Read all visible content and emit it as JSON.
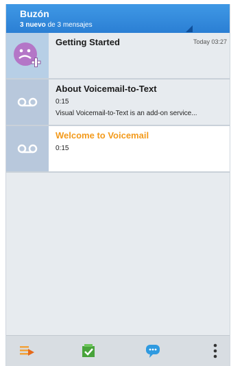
{
  "header": {
    "title": "Buzón",
    "new_count": "3 nuevo",
    "rest": "de 3 mensajes"
  },
  "messages": [
    {
      "name": "Getting Started",
      "time": "Today 03:27",
      "duration": "",
      "preview": "",
      "icon": "contact-avatar-icon",
      "unread": false
    },
    {
      "name": "About Voicemail-to-Text",
      "time": "",
      "duration": "0:15",
      "preview": "Visual Voicemail-to-Text is an add-on service...",
      "icon": "voicemail-icon",
      "unread": false
    },
    {
      "name": "Welcome to Voicemail",
      "time": "",
      "duration": "0:15",
      "preview": "",
      "icon": "voicemail-icon",
      "unread": true
    }
  ],
  "toolbar": {
    "icons": [
      "play-list-icon",
      "mark-read-icon",
      "message-icon",
      "more-options-icon"
    ]
  },
  "colors": {
    "header": "#2b7fd4",
    "unread_name": "#f39a1b",
    "thumb": "#b8c8dc"
  }
}
